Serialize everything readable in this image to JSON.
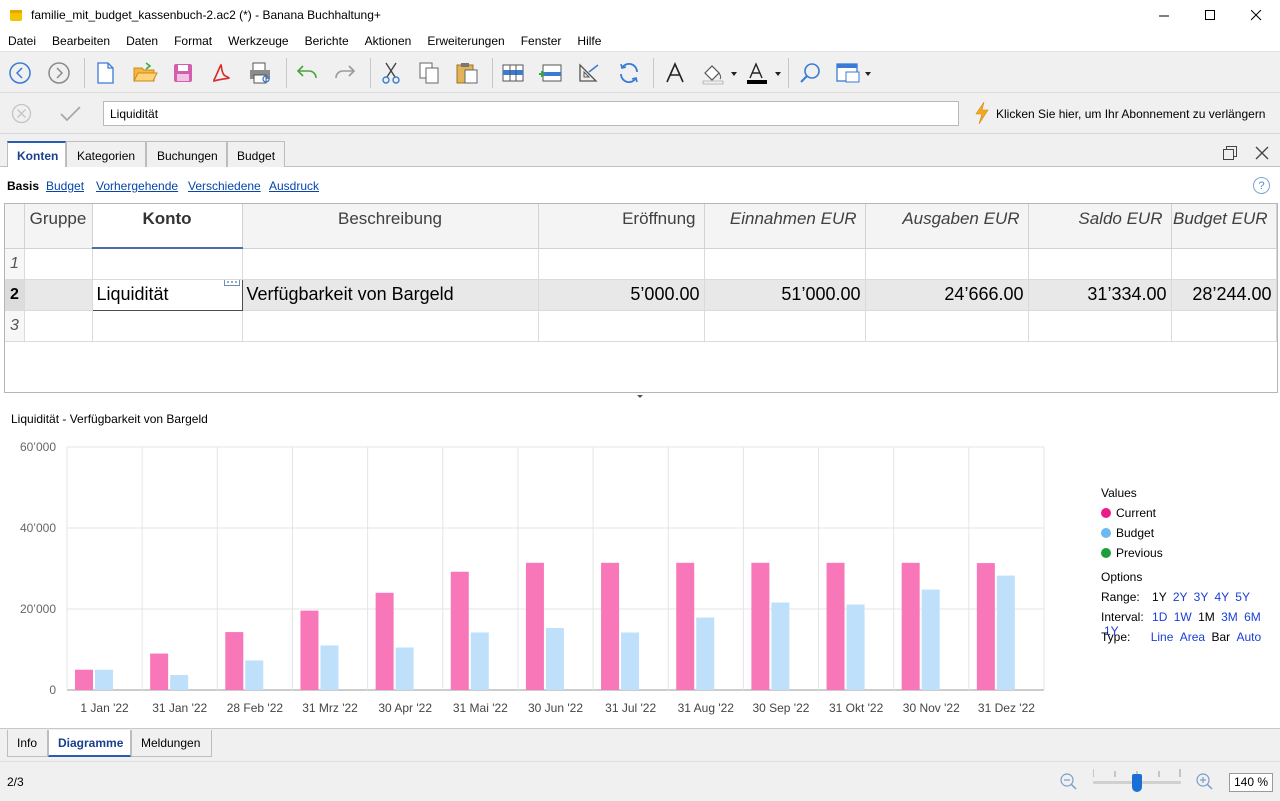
{
  "window": {
    "title": "familie_mit_budget_kassenbuch-2.ac2 (*) - Banana Buchhaltung+",
    "minimize": "—",
    "maximize": "☐",
    "close": "✕"
  },
  "menu": [
    "Datei",
    "Bearbeiten",
    "Daten",
    "Format",
    "Werkzeuge",
    "Berichte",
    "Aktionen",
    "Erweiterungen",
    "Fenster",
    "Hilfe"
  ],
  "inputbar": {
    "value": "Liquidität",
    "subscription": "Klicken Sie hier, um Ihr Abonnement zu verlängern"
  },
  "tabs": [
    "Konten",
    "Kategorien",
    "Buchungen",
    "Budget"
  ],
  "views": {
    "current": "Basis",
    "links": [
      "Budget",
      "Vorhergehende",
      "Verschiedene",
      "Ausdruck"
    ],
    "help": "?"
  },
  "table": {
    "headers": [
      "Gruppe",
      "Konto",
      "Beschreibung",
      "Eröffnung",
      "Einnahmen EUR",
      "Ausgaben EUR",
      "Saldo EUR",
      "Budget EUR"
    ],
    "rows": [
      {
        "num": "1",
        "gruppe": "",
        "konto": "",
        "beschreibung": "",
        "eroeffnung": "",
        "einnahmen": "",
        "ausgaben": "",
        "saldo": "",
        "budget": ""
      },
      {
        "num": "2",
        "gruppe": "",
        "konto": "Liquidität",
        "beschreibung": "Verfügbarkeit von Bargeld",
        "eroeffnung": "5’000.00",
        "einnahmen": "51’000.00",
        "ausgaben": "24’666.00",
        "saldo": "31’334.00",
        "budget": "28’244.00"
      },
      {
        "num": "3",
        "gruppe": "",
        "konto": "",
        "beschreibung": "",
        "eroeffnung": "",
        "einnahmen": "",
        "ausgaben": "",
        "saldo": "",
        "budget": ""
      }
    ]
  },
  "chart_data": {
    "type": "bar",
    "title": "Liquidität - Verfügbarkeit von Bargeld",
    "categories": [
      "1 Jan '22",
      "31 Jan '22",
      "28 Feb '22",
      "31 Mrz '22",
      "30 Apr '22",
      "31 Mai '22",
      "30 Jun '22",
      "31 Jul '22",
      "31 Aug '22",
      "30 Sep '22",
      "31 Okt '22",
      "30 Nov '22",
      "31 Dez '22"
    ],
    "series": [
      {
        "name": "Current",
        "color": "#f777b8",
        "values": [
          5000,
          9000,
          14300,
          19600,
          24000,
          29200,
          31400,
          31400,
          31400,
          31400,
          31400,
          31400,
          31334
        ]
      },
      {
        "name": "Budget",
        "color": "#bfe0fb",
        "values": [
          5000,
          3700,
          7300,
          11000,
          10500,
          14200,
          15300,
          14200,
          17900,
          21600,
          21100,
          24800,
          28244
        ]
      }
    ],
    "ylim": [
      0,
      60000
    ],
    "yticks": [
      "0",
      "20’000",
      "40’000",
      "60’000"
    ],
    "grid": true,
    "legend": "right"
  },
  "legend": {
    "values_label": "Values",
    "items": [
      {
        "name": "Current",
        "color": "#ec1a8c"
      },
      {
        "name": "Budget",
        "color": "#6cb8f0"
      },
      {
        "name": "Previous",
        "color": "#1e9e3a"
      }
    ],
    "options_label": "Options",
    "range_label": "Range:",
    "range": [
      "1Y",
      "2Y",
      "3Y",
      "4Y",
      "5Y"
    ],
    "interval_label": "Interval:",
    "interval": [
      "1D",
      "1W",
      "1M",
      "3M",
      "6M",
      "1Y"
    ],
    "type_label": "Type:",
    "types": [
      "Line",
      "Area",
      "Bar",
      "Auto"
    ]
  },
  "bottom_tabs": [
    "Info",
    "Diagramme",
    "Meldungen"
  ],
  "status": {
    "position": "2/3",
    "zoom": "140 %",
    "zoom_level": 0.5
  }
}
